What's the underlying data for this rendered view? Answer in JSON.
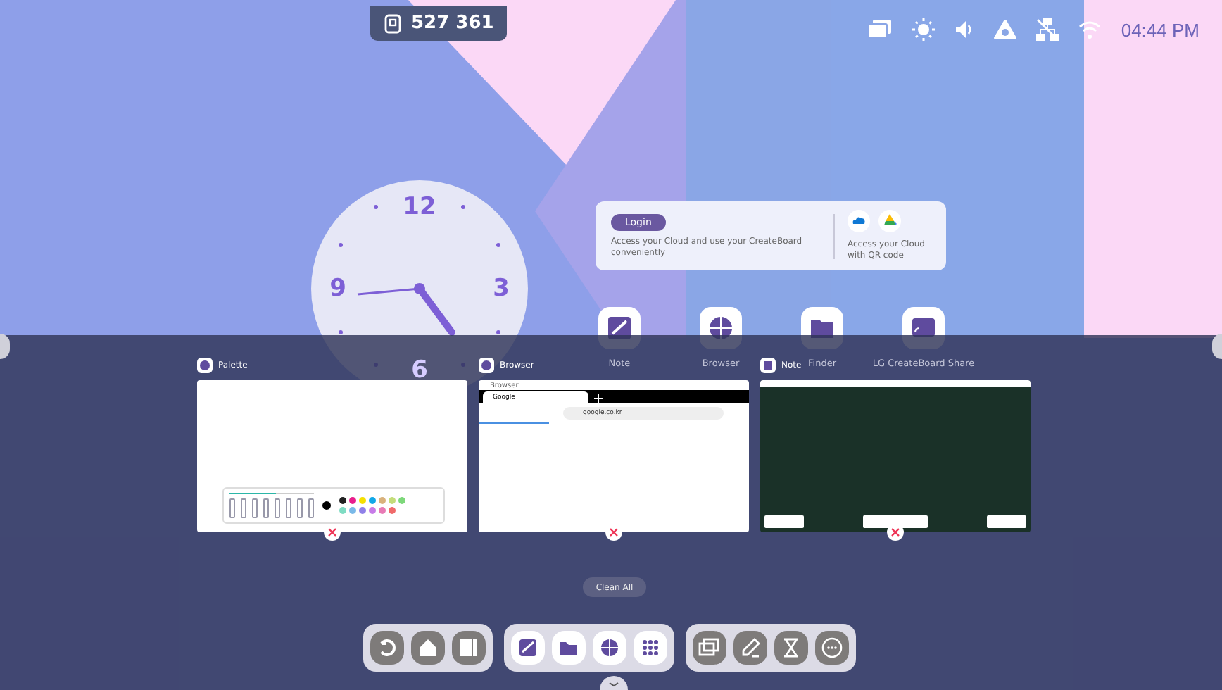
{
  "top_bar": {
    "screen_code": "527 361",
    "time": "04:44 PM"
  },
  "clock": {
    "numerals": [
      "12",
      "3",
      "6",
      "9"
    ]
  },
  "cloud_card": {
    "login_button": "Login",
    "description": "Access your Cloud and use your CreateBoard conveniently",
    "qr_text": "Access your Cloud with QR code"
  },
  "desktop_apps": [
    {
      "label": "Note",
      "kind": "note"
    },
    {
      "label": "Browser",
      "kind": "browser"
    },
    {
      "label": "Finder",
      "kind": "finder"
    },
    {
      "label": "LG CreateBoard Share",
      "kind": "share"
    }
  ],
  "recent_apps": [
    {
      "name": "Palette",
      "kind": "palette"
    },
    {
      "name": "Browser",
      "kind": "browser",
      "window_title": "Browser",
      "tab": "Google",
      "url": "google.co.kr"
    },
    {
      "name": "Note",
      "kind": "note"
    }
  ],
  "clean_all": "Clean All",
  "dock": [
    {
      "items": [
        {
          "kind": "back"
        },
        {
          "kind": "home"
        },
        {
          "kind": "split"
        }
      ]
    },
    {
      "items": [
        {
          "kind": "note"
        },
        {
          "kind": "finder"
        },
        {
          "kind": "browser"
        },
        {
          "kind": "apps"
        }
      ]
    },
    {
      "items": [
        {
          "kind": "screen"
        },
        {
          "kind": "pen"
        },
        {
          "kind": "timer"
        },
        {
          "kind": "more"
        }
      ]
    }
  ]
}
